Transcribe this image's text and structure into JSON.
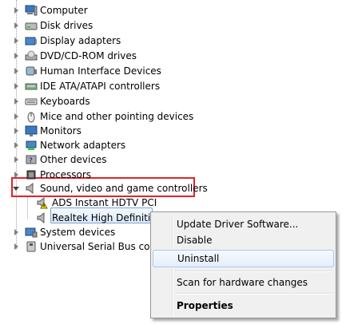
{
  "tree": {
    "items": [
      {
        "label": "Computer",
        "icon": "computer-icon"
      },
      {
        "label": "Disk drives",
        "icon": "disk-drive-icon"
      },
      {
        "label": "Display adapters",
        "icon": "display-adapter-icon"
      },
      {
        "label": "DVD/CD-ROM drives",
        "icon": "dvd-drive-icon"
      },
      {
        "label": "Human Interface Devices",
        "icon": "hid-icon"
      },
      {
        "label": "IDE ATA/ATAPI controllers",
        "icon": "ide-controller-icon"
      },
      {
        "label": "Keyboards",
        "icon": "keyboard-icon"
      },
      {
        "label": "Mice and other pointing devices",
        "icon": "mouse-icon"
      },
      {
        "label": "Monitors",
        "icon": "monitor-icon"
      },
      {
        "label": "Network adapters",
        "icon": "network-adapter-icon"
      },
      {
        "label": "Other devices",
        "icon": "other-devices-icon"
      },
      {
        "label": "Processors",
        "icon": "processor-icon"
      },
      {
        "label": "Sound, video and game controllers",
        "icon": "speaker-icon",
        "expanded": true
      },
      {
        "label": "ADS Instant HDTV PCI",
        "icon": "warning-device-icon",
        "child": true
      },
      {
        "label": "Realtek High Definition",
        "icon": "speaker-icon",
        "child": true,
        "selected": true
      },
      {
        "label": "System devices",
        "icon": "system-devices-icon"
      },
      {
        "label": "Universal Serial Bus contro",
        "icon": "usb-icon"
      }
    ]
  },
  "context_menu": {
    "items": [
      {
        "label": "Update Driver Software..."
      },
      {
        "label": "Disable"
      },
      {
        "label": "Uninstall",
        "hover": true
      },
      {
        "label": "Scan for hardware changes"
      },
      {
        "label": "Properties",
        "bold": true
      }
    ]
  },
  "colors": {
    "highlight_border": "#e0242a",
    "selection_border": "#7da2ce",
    "menu_background": "#f0f0f0"
  }
}
